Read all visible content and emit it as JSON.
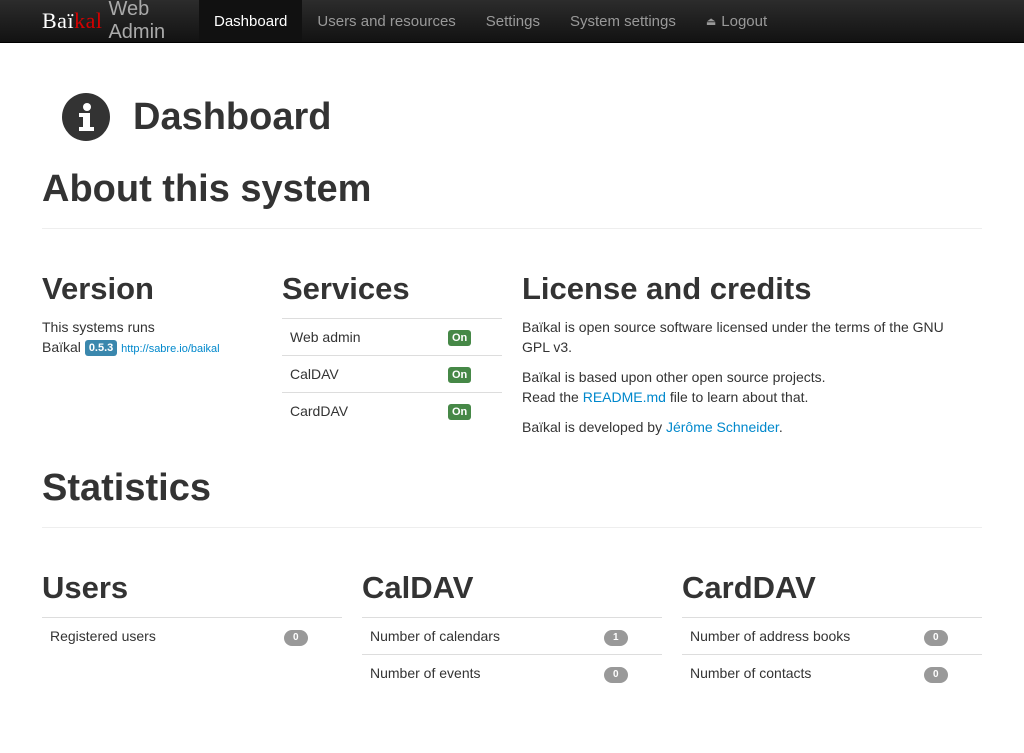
{
  "navbar": {
    "brand": {
      "b": "Baï",
      "red": "kal",
      "suffix": "Web Admin"
    },
    "items": [
      {
        "label": "Dashboard",
        "active": true
      },
      {
        "label": "Users and resources"
      },
      {
        "label": "Settings"
      },
      {
        "label": "System settings"
      }
    ],
    "logout": {
      "label": "Logout",
      "icon": "eject-icon"
    }
  },
  "page": {
    "title": "Dashboard",
    "icon": "info-icon"
  },
  "about": {
    "title": "About this system",
    "version": {
      "title": "Version",
      "line1": "This systems runs",
      "name": "Baïkal",
      "badge": "0.5.3",
      "link": "http://sabre.io/baikal"
    },
    "services": {
      "title": "Services",
      "rows": [
        {
          "name": "Web admin",
          "status": "On"
        },
        {
          "name": "CalDAV",
          "status": "On"
        },
        {
          "name": "CardDAV",
          "status": "On"
        }
      ]
    },
    "license": {
      "title": "License and credits",
      "p1": "Baïkal is open source software licensed under the terms of the GNU GPL v3.",
      "p2_line1": "Baïkal is based upon other open source projects.",
      "p2_pre": "Read the ",
      "p2_link": "README.md",
      "p2_post": " file to learn about that.",
      "p3_pre": "Baïkal is developed by ",
      "p3_link": "Jérôme Schneider",
      "p3_post": "."
    }
  },
  "statistics": {
    "title": "Statistics",
    "users": {
      "title": "Users",
      "rows": [
        {
          "label": "Registered users",
          "value": "0"
        }
      ]
    },
    "caldav": {
      "title": "CalDAV",
      "rows": [
        {
          "label": "Number of calendars",
          "value": "1"
        },
        {
          "label": "Number of events",
          "value": "0"
        }
      ]
    },
    "carddav": {
      "title": "CardDAV",
      "rows": [
        {
          "label": "Number of address books",
          "value": "0"
        },
        {
          "label": "Number of contacts",
          "value": "0"
        }
      ]
    }
  },
  "colors": {
    "navbar": "#1b1b1b",
    "brand_red": "#d40000",
    "badge_blue": "#3a87ad",
    "label_on": "#468847",
    "badge_grey": "#999999",
    "link": "#0088cc"
  }
}
